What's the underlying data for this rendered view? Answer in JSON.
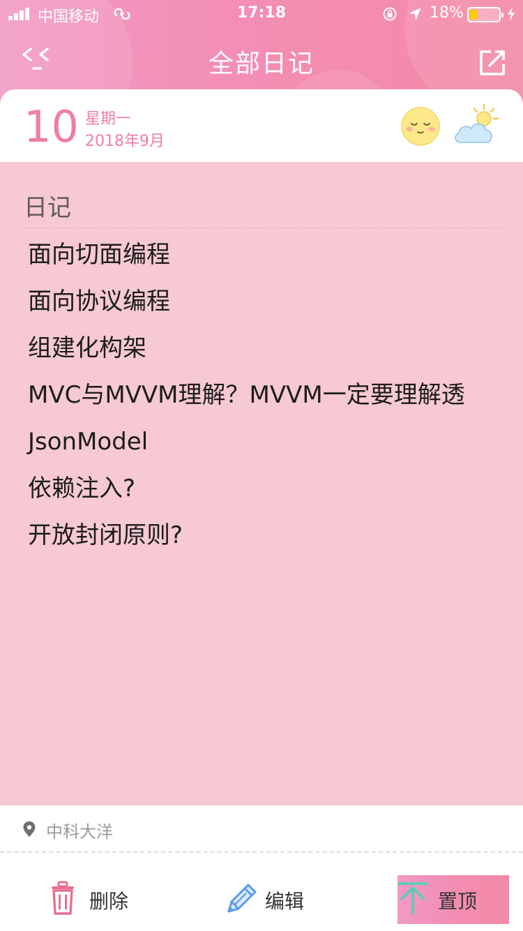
{
  "status_bar": {
    "carrier": "中国移动",
    "time": "17:18",
    "battery_percent": "18%",
    "battery_level": 0.18
  },
  "nav": {
    "title": "全部日记",
    "back_icon": "back-arrow-icon",
    "share_icon": "share-external-icon"
  },
  "entry": {
    "day": "10",
    "weekday": "星期一",
    "month": "2018年9月",
    "mood_icon": "content-face-icon",
    "weather_icon": "partly-cloudy-icon"
  },
  "diary": {
    "section_label": "日记",
    "lines": [
      "面向切面编程",
      "面向协议编程",
      "组建化构架",
      "MVC与MVVM理解？MVVM一定要理解透",
      "JsonModel",
      "依赖注入?",
      "开放封闭原则?"
    ]
  },
  "footer": {
    "location": "中科大洋",
    "delete_label": "删除",
    "edit_label": "编辑",
    "pin_label": "置顶"
  },
  "colors": {
    "header_pink": "#f38db3",
    "accent_pink": "#ee7fa2",
    "content_bg": "#f6c9d3",
    "delete_icon": "#e8708f",
    "edit_icon": "#5b9be8",
    "pin_icon": "#4fd1b6"
  }
}
